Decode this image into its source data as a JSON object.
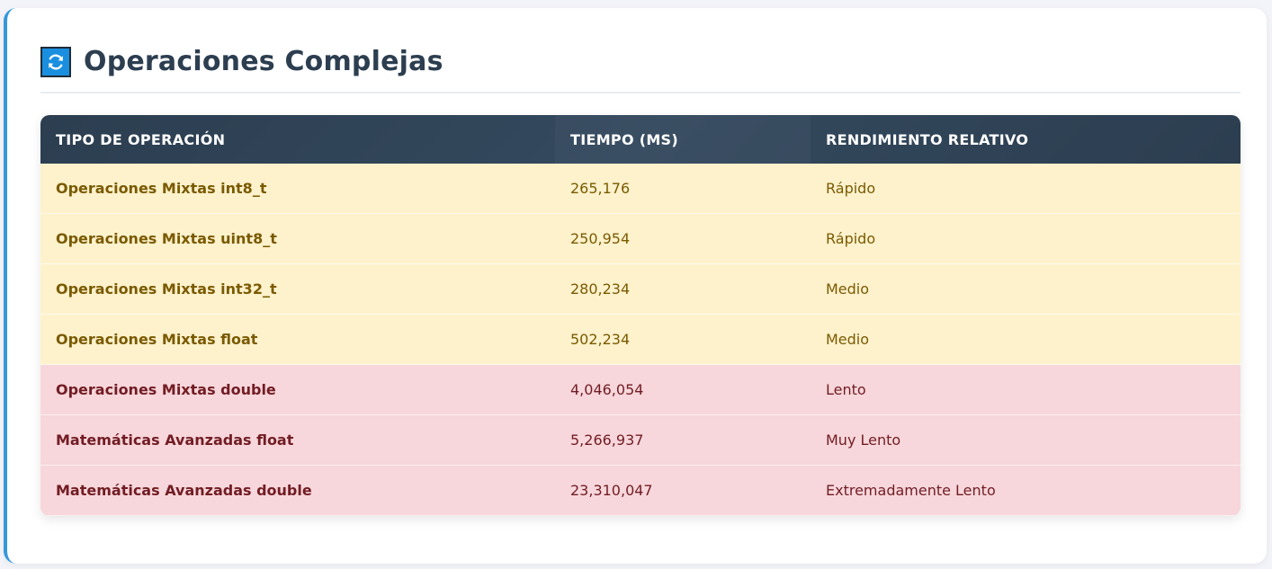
{
  "section": {
    "title": "Operaciones Complejas",
    "icon": "refresh-icon",
    "accent_color": "#3498db"
  },
  "table": {
    "headers": [
      "Tipo de Operación",
      "Tiempo (ms)",
      "Rendimiento Relativo"
    ],
    "rows": [
      {
        "name": "Operaciones Mixtas int8_t",
        "time": "265,176",
        "rating": "Rápido",
        "status": "fast"
      },
      {
        "name": "Operaciones Mixtas uint8_t",
        "time": "250,954",
        "rating": "Rápido",
        "status": "fast"
      },
      {
        "name": "Operaciones Mixtas int32_t",
        "time": "280,234",
        "rating": "Medio",
        "status": "medium"
      },
      {
        "name": "Operaciones Mixtas float",
        "time": "502,234",
        "rating": "Medio",
        "status": "medium"
      },
      {
        "name": "Operaciones Mixtas double",
        "time": "4,046,054",
        "rating": "Lento",
        "status": "slow"
      },
      {
        "name": "Matemáticas Avanzadas float",
        "time": "5,266,937",
        "rating": "Muy Lento",
        "status": "slow"
      },
      {
        "name": "Matemáticas Avanzadas double",
        "time": "23,310,047",
        "rating": "Extremadamente Lento",
        "status": "slow"
      }
    ]
  },
  "colors": {
    "header_bg": "#2c3e50",
    "warning_row_bg": "#fef2cd",
    "warning_text": "#7a5a00",
    "danger_row_bg": "#f7d7db",
    "danger_text": "#721c24"
  }
}
